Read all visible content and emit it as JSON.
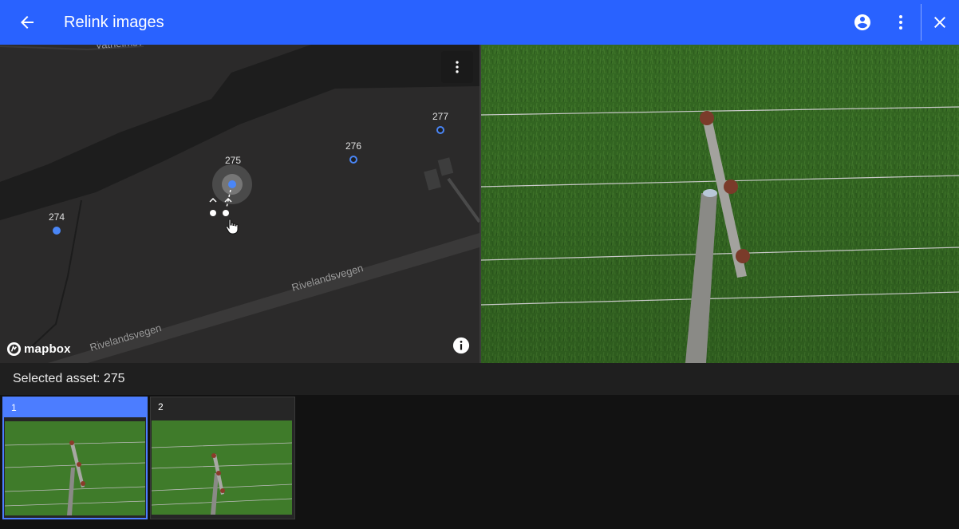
{
  "header": {
    "title": "Relink images"
  },
  "map": {
    "markers": [
      {
        "id": "274",
        "label": "274"
      },
      {
        "id": "275",
        "label": "275"
      },
      {
        "id": "276",
        "label": "276"
      },
      {
        "id": "277",
        "label": "277"
      }
    ],
    "street_labels": [
      "Vatheimsv",
      "Rivelandsvegen",
      "Rivelandsvegen"
    ],
    "logo_text": "mapbox"
  },
  "selected": {
    "text": "Selected asset: 275"
  },
  "thumbnails": [
    {
      "number": "1",
      "selected": true
    },
    {
      "number": "2",
      "selected": false
    }
  ],
  "colors": {
    "app_bar": "#2962ff",
    "accent": "#4c7dff",
    "map_background": "#2b2a2a",
    "river": "#1d1d1d",
    "road": "#3a3939",
    "marker": "#4a86f7",
    "grass": "#3d7a28"
  }
}
